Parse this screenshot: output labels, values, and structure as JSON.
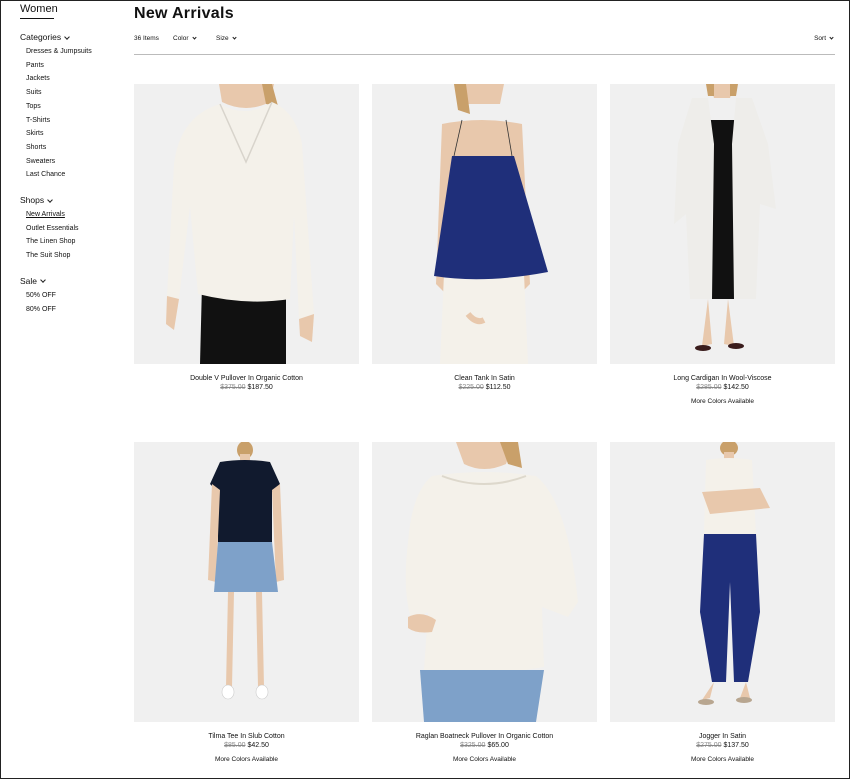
{
  "sidebar": {
    "title": "Women",
    "groups": [
      {
        "label": "Categories",
        "items": [
          "Dresses & Jumpsuits",
          "Pants",
          "Jackets",
          "Suits",
          "Tops",
          "T-Shirts",
          "Skirts",
          "Shorts",
          "Sweaters",
          "Last Chance"
        ]
      },
      {
        "label": "Shops",
        "items": [
          "New Arrivals",
          "Outlet Essentials",
          "The Linen Shop",
          "The Suit Shop"
        ],
        "active_item": "New Arrivals"
      },
      {
        "label": "Sale",
        "items": [
          "50% OFF",
          "80% OFF"
        ]
      }
    ]
  },
  "header": {
    "title": "New Arrivals",
    "count": "36 Items",
    "color_filter": "Color",
    "size_filter": "Size",
    "sort": "Sort"
  },
  "products": [
    {
      "name": "Double V Pullover In Organic Cotton",
      "old_price": "$375.00",
      "price": "$187.50",
      "more": ""
    },
    {
      "name": "Clean Tank In Satin",
      "old_price": "$225.00",
      "price": "$112.50",
      "more": ""
    },
    {
      "name": "Long Cardigan In Wool-Viscose",
      "old_price": "$285.00",
      "price": "$142.50",
      "more": "More Colors Available"
    },
    {
      "name": "Tilma Tee In Slub Cotton",
      "old_price": "$85.00",
      "price": "$42.50",
      "more": "More Colors Available"
    },
    {
      "name": "Raglan Boatneck Pullover In Organic Cotton",
      "old_price": "$325.00",
      "price": "$65.00",
      "more": "More Colors Available"
    },
    {
      "name": "Jogger In Satin",
      "old_price": "$275.00",
      "price": "$137.50",
      "more": "More Colors Available"
    }
  ],
  "colors": {
    "image_bg": "#f0f0f0",
    "navy": "#1f2f7a",
    "black": "#111111",
    "cream": "#f4f1ea",
    "denim": "#7ea1c9",
    "skin": "#e8c8ac",
    "hair": "#c9a06a"
  }
}
